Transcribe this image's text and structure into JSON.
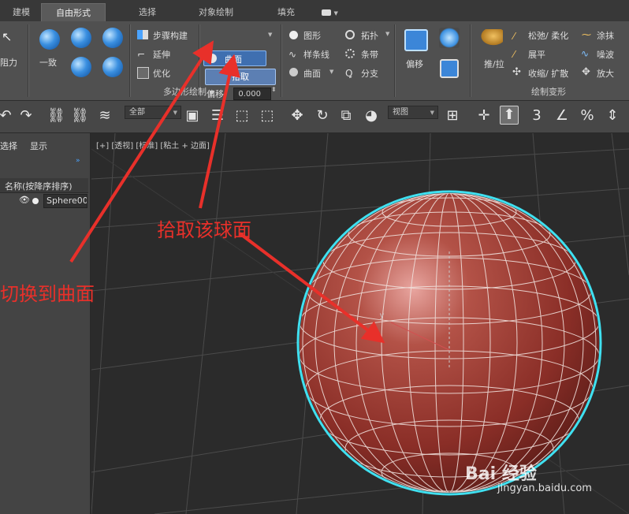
{
  "ribbon_tabs": [
    {
      "label": "建模"
    },
    {
      "label": "自由形式"
    },
    {
      "label": "选择"
    },
    {
      "label": "对象绘制"
    },
    {
      "label": "填充"
    }
  ],
  "ribbon": {
    "left_partial": "阻力",
    "consistent": "一致",
    "step_build": "步骤构建",
    "extend": "延伸",
    "optimize": "优化",
    "surface_btn": "曲面",
    "pick_btn": "拾取",
    "offset_label": "偏移:",
    "offset_value": "0.000",
    "shapes": "图形",
    "splines": "样条线",
    "surface_dd": "曲面",
    "topology": "拓扑",
    "strips": "条带",
    "branches": "分支",
    "offset_tool": "偏移",
    "push_pull": "推/拉",
    "relax": "松弛/ 柔化",
    "flatten": "展平",
    "shrink": "收缩/ 扩散",
    "smudge": "涂抹",
    "noise": "噪波",
    "enlarge": "放大",
    "group_poly_draw": "多边形绘制",
    "group_paint_deform": "绘制变形"
  },
  "toolbar": {
    "selection_filter": "全部",
    "ref_coord": "视图"
  },
  "explorer": {
    "tab_select": "选择",
    "tab_display": "显示",
    "column_header": "名称(按降序排序)",
    "object_name": "Sphere00"
  },
  "viewport": {
    "label": "[+] [透视] [标准] [粘土 + 边面]"
  },
  "annotations": {
    "switch_to_surface": "切换到曲面",
    "pick_sphere_face": "拾取该球面"
  },
  "watermark": {
    "main": "Bai 经验",
    "sub": "jingyan.baidu.com"
  },
  "colors": {
    "annotation_red": "#e8302a",
    "selection_cyan": "#40e0f0",
    "sphere_red": "#9b3a33"
  }
}
